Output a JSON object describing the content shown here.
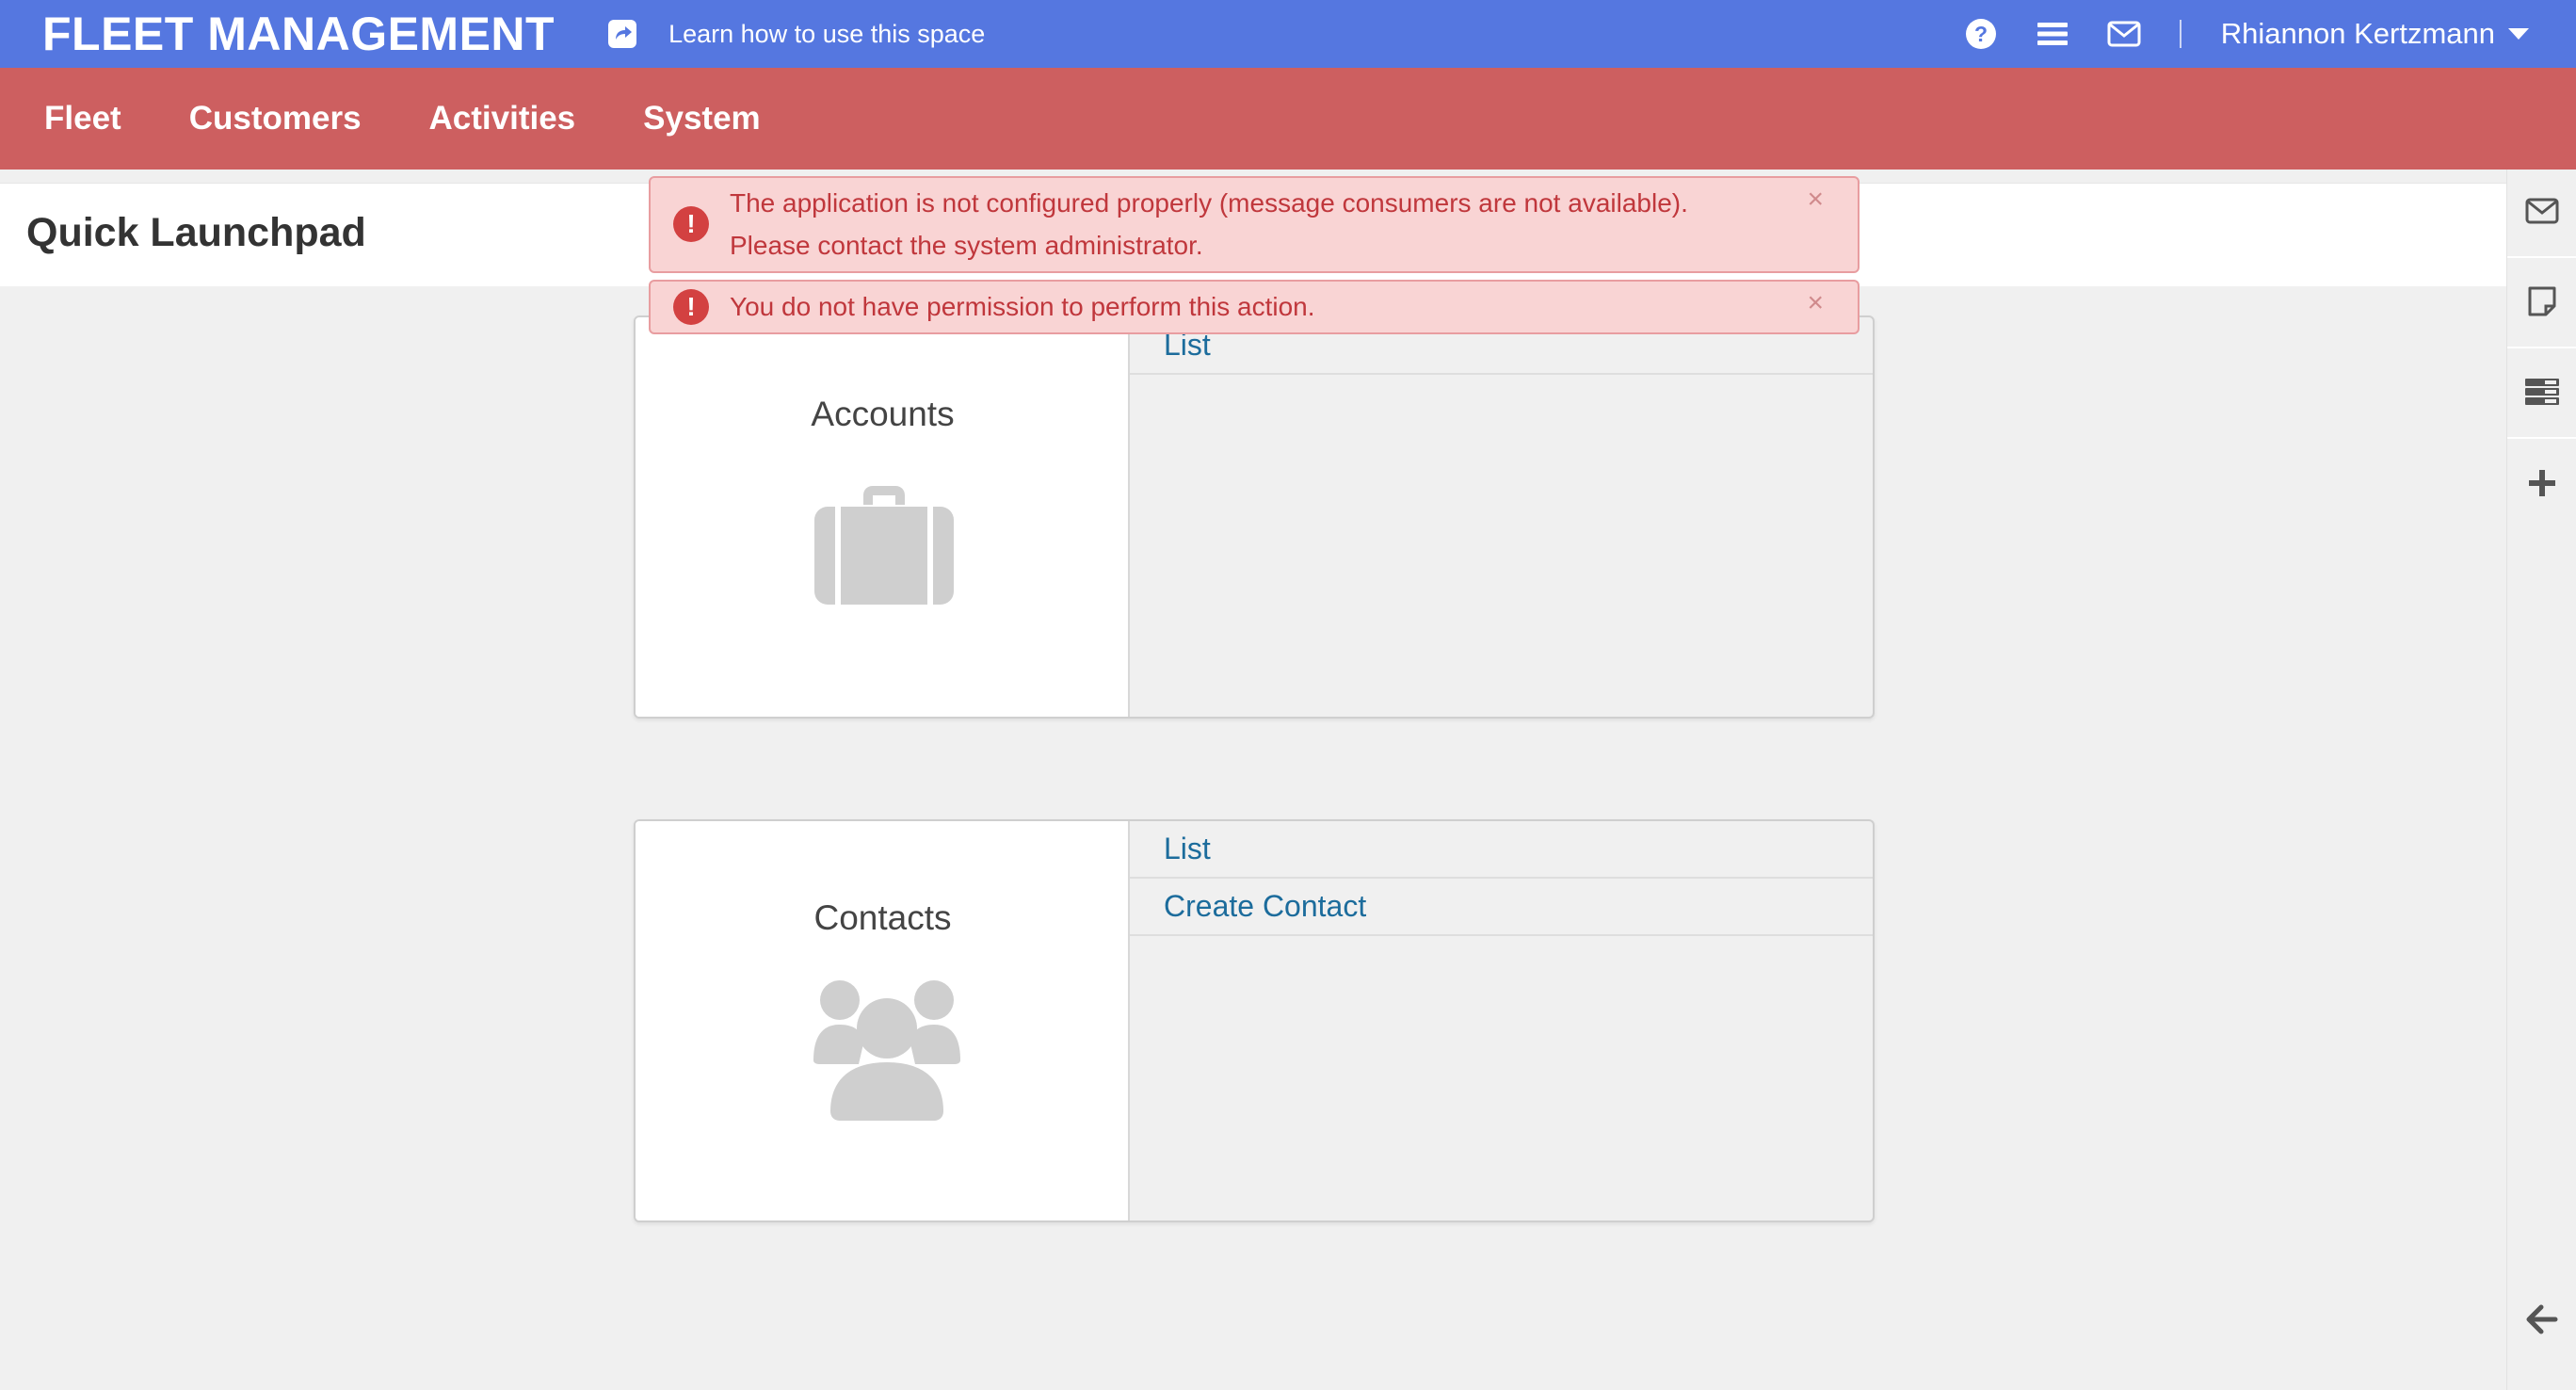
{
  "header": {
    "brand": "FLEET MANAGEMENT",
    "learn_link": "Learn how to use this space",
    "user_name": "Rhiannon Kertzmann",
    "icons": [
      "share-icon",
      "help-icon",
      "menu-icon",
      "mail-icon",
      "caret-down-icon"
    ]
  },
  "nav": {
    "items": [
      {
        "label": "Fleet"
      },
      {
        "label": "Customers"
      },
      {
        "label": "Activities"
      },
      {
        "label": "System"
      }
    ]
  },
  "page": {
    "title": "Quick Launchpad"
  },
  "alerts": [
    {
      "line1": "The application is not configured properly (message consumers are not available).",
      "line2": "Please contact the system administrator.",
      "close": "×"
    },
    {
      "line1": "You do not have permission to perform this action.",
      "close": "×"
    }
  ],
  "cards": [
    {
      "title": "Accounts",
      "icon": "briefcase-icon",
      "links": [
        "List"
      ]
    },
    {
      "title": "Contacts",
      "icon": "users-icon",
      "links": [
        "List",
        "Create Contact"
      ]
    }
  ],
  "sidebar": {
    "icons": [
      "mail-icon",
      "note-icon",
      "tasks-icon",
      "plus-icon",
      "collapse-arrow-icon"
    ]
  },
  "colors": {
    "header_bg": "#5577e0",
    "nav_bg": "#cd5f60",
    "alert_bg": "#f9d4d4",
    "alert_text": "#c0373c",
    "link": "#1c6c9c"
  }
}
